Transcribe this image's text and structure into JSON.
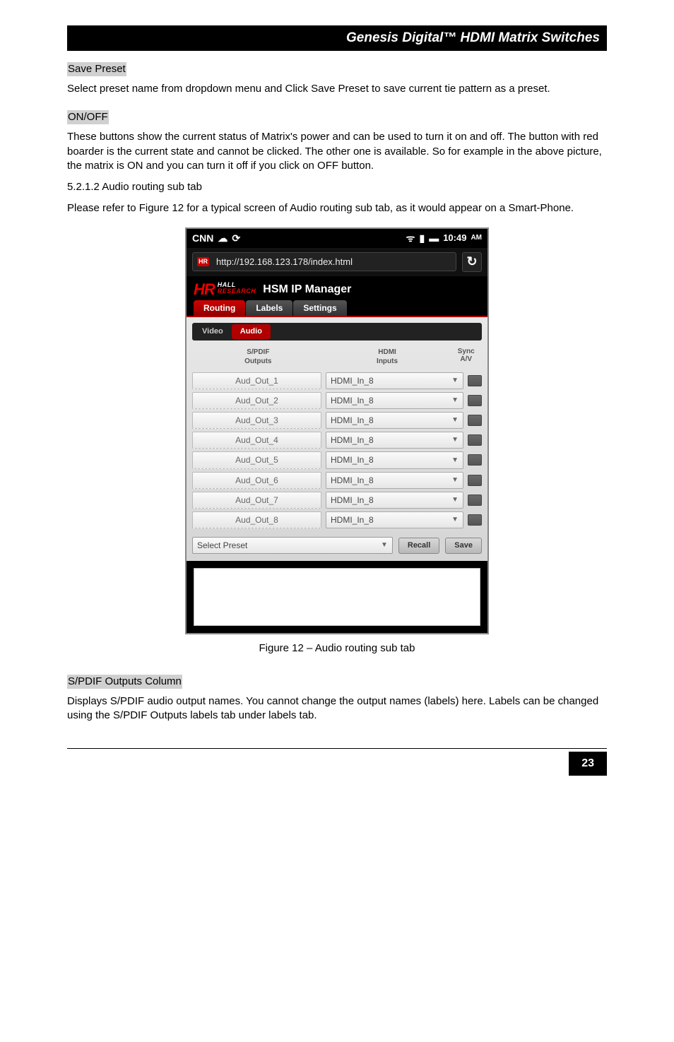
{
  "header": {
    "title": "Genesis Digital™ HDMI Matrix Switches"
  },
  "sections": {
    "savePreset": {
      "heading": "Save Preset",
      "body": "Select preset name from dropdown menu and Click Save Preset to save current tie pattern as a preset."
    },
    "onOff": {
      "heading": "ON/OFF",
      "body": "These buttons show the current status of Matrix's power and can be used to turn it on and off. The button with red boarder is the current state and cannot be clicked. The other one is available. So for example in the above picture, the matrix is ON and you can turn it off if you click on OFF button."
    },
    "audioSub": {
      "heading": "5.2.1.2 Audio routing sub tab",
      "body": "Please refer to Figure 12 for a typical screen of Audio routing sub tab, as it would appear on a Smart-Phone."
    },
    "spdif": {
      "heading": "S/PDIF Outputs Column",
      "body": "Displays S/PDIF audio output names. You cannot change the output names (labels) here. Labels can be changed using the S/PDIF Outputs labels tab under labels tab."
    }
  },
  "phone": {
    "statusTime": "10:49",
    "statusAmPm": "AM",
    "url": "http://192.168.123.178/index.html",
    "logoTop": "HR",
    "logoHall": "HALL",
    "logoResearch": "RESEARCH",
    "appTitle": "HSM IP Manager",
    "mainTabs": {
      "routing": "Routing",
      "labels": "Labels",
      "settings": "Settings"
    },
    "subTabs": {
      "video": "Video",
      "audio": "Audio"
    },
    "tableHead": {
      "left1": "S/PDIF",
      "left2": "Outputs",
      "mid1": "HDMI",
      "mid2": "Inputs",
      "right1": "Sync",
      "right2": "A/V"
    },
    "rows": [
      {
        "out": "Aud_Out_1",
        "in": "HDMI_In_8"
      },
      {
        "out": "Aud_Out_2",
        "in": "HDMI_In_8"
      },
      {
        "out": "Aud_Out_3",
        "in": "HDMI_In_8"
      },
      {
        "out": "Aud_Out_4",
        "in": "HDMI_In_8"
      },
      {
        "out": "Aud_Out_5",
        "in": "HDMI_In_8"
      },
      {
        "out": "Aud_Out_6",
        "in": "HDMI_In_8"
      },
      {
        "out": "Aud_Out_7",
        "in": "HDMI_In_8"
      },
      {
        "out": "Aud_Out_8",
        "in": "HDMI_In_8"
      }
    ],
    "preset": {
      "select": "Select Preset",
      "recall": "Recall",
      "save": "Save"
    }
  },
  "figure": {
    "caption": "Figure 12 – Audio routing sub tab"
  },
  "footer": {
    "page": "23"
  }
}
